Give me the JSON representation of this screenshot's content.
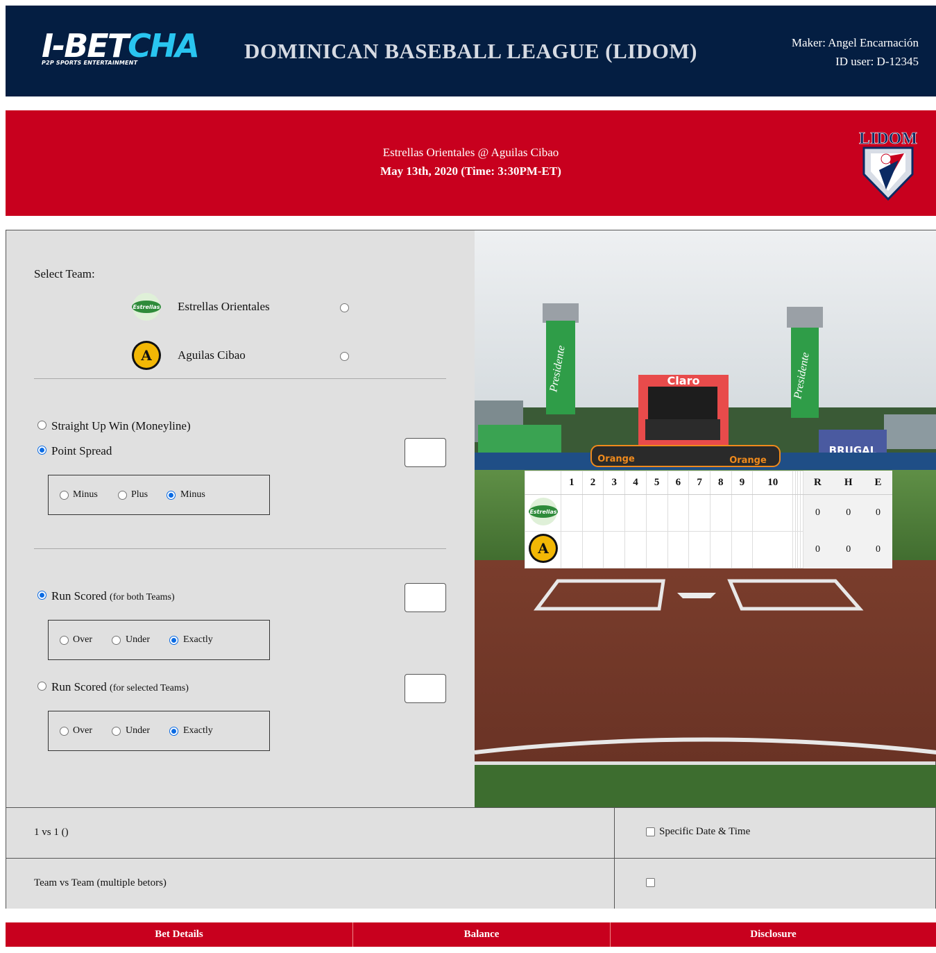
{
  "header": {
    "logo_word_1": "I-BET",
    "logo_word_2": "CHA",
    "logo_tagline": "P2P SPORTS ENTERTAINMENT",
    "title": "DOMINICAN BASEBALL LEAGUE (LIDOM)",
    "maker": "Maker: Angel Encarnación",
    "user_id": "ID user: D-12345"
  },
  "match": {
    "teams": "Estrellas Orientales @ Aguilas Cibao",
    "datetime": "May 13th, 2020 (Time: 3:30PM-ET)",
    "league_logo_text": "LIDOM"
  },
  "select_team": {
    "label": "Select Team:",
    "teams": [
      {
        "name": "Estrellas Orientales",
        "icon": "estrellas-logo-icon",
        "logo_text": "Estrellas",
        "color": "#2e8b3a"
      },
      {
        "name": "Aguilas Cibao",
        "icon": "aguilas-logo-icon",
        "logo_text": "A",
        "color": "#f2b705"
      }
    ]
  },
  "bet_types": {
    "moneyline": "Straight Up Win (Moneyline)",
    "point_spread": "Point Spread",
    "spread_options": [
      "Minus",
      "Plus",
      "Minus"
    ],
    "run_scored_both": "Run Scored",
    "run_scored_both_note": "(for both Teams)",
    "run_scored_selected": "Run Scored",
    "run_scored_selected_note": "(for selected Teams)",
    "ou_options": [
      "Over",
      "Under",
      "Exactly"
    ]
  },
  "scoreboard": {
    "innings": [
      "1",
      "2",
      "3",
      "4",
      "5",
      "6",
      "7",
      "8",
      "9",
      "10"
    ],
    "totals_headers": [
      "R",
      "H",
      "E"
    ],
    "rows": [
      {
        "team": "Estrellas Orientales",
        "totals": [
          "0",
          "0",
          "0"
        ]
      },
      {
        "team": "Aguilas Cibao",
        "totals": [
          "0",
          "0",
          "0"
        ]
      }
    ]
  },
  "stadium_signs": {
    "left_banner": "Presidente",
    "right_banner": "Presidente",
    "scoreboard_brand": "Claro",
    "wall_left": "Orange",
    "wall_right": "Orange",
    "sponsor": "BRUGAL"
  },
  "bet_mode": {
    "one_vs_one": "1 vs 1 ()",
    "team_vs_team": "Team vs Team (multiple betors)",
    "specific_date": "Specific Date & Time"
  },
  "footer": {
    "tabs": [
      "Bet Details",
      "Balance",
      "Disclosure"
    ]
  },
  "colors": {
    "navy": "#041e42",
    "red": "#c8001e",
    "accent_cyan": "#29c5f0",
    "panel_gray": "#e0e0e0",
    "radio_blue": "#0b6be3"
  }
}
